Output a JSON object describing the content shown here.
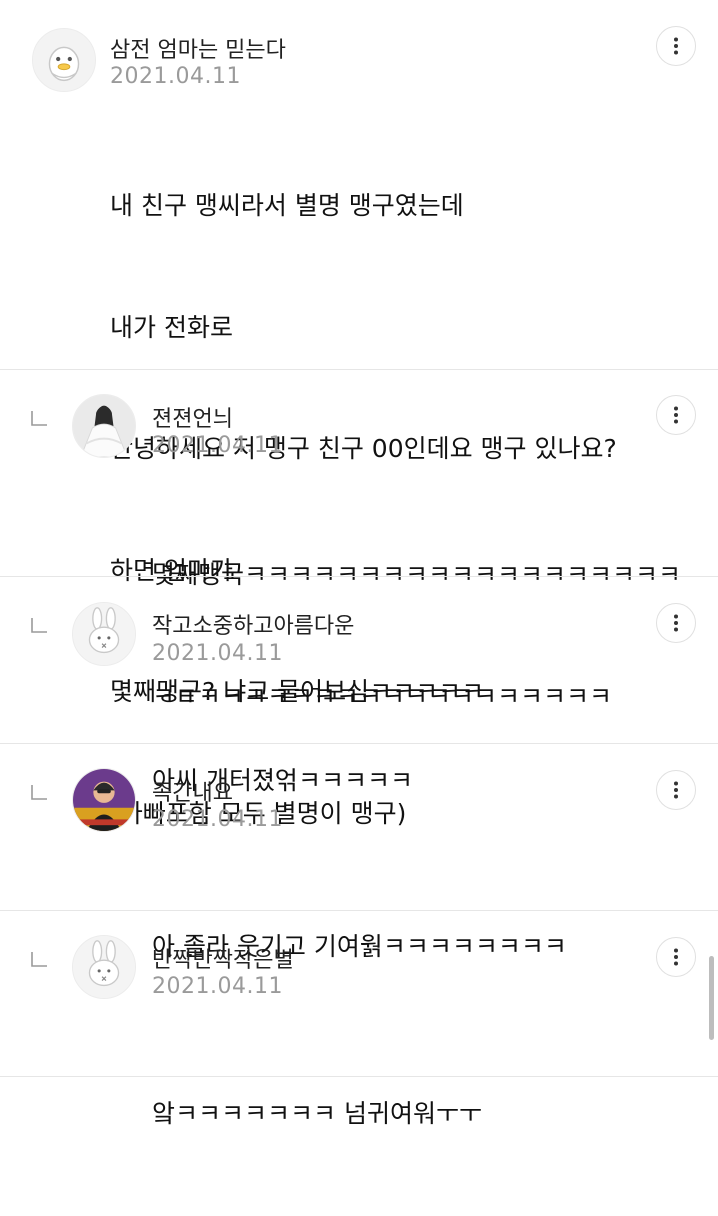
{
  "comments": [
    {
      "author": "삼전 엄마는 믿는다",
      "date": "2021.04.11",
      "avatar": "duck-avatar",
      "lines": [
        "내 친구 맹씨라서 별명 맹구였는데",
        "내가 전화로",
        "안녕하세요 저 맹구 친구 00인데요 맹구 있나요?",
        "하면 엄마가",
        "몇째맹구? 냐고 물어보심ㅋㅋㅋㅋㅋ",
        "(아빠포함 모두 별명이 맹구)"
      ]
    },
    {
      "author": "젼젼언늬",
      "date": "2021.04.11",
      "avatar": "photo-avatar-white-dress",
      "reply": true,
      "lines": [
        "몇째맹국ㅋㅋㅋㅋㅋㅋㅋㅋㅋㅋㅋㅋㅋㅋㅋㅋㅋㅋㅋ",
        "ㅋㅌㅋㅋㅋㅋㅋㅋㅋㅋㅋㅋㅋㅋㅋㅋㅋㅋㅋㅋ"
      ]
    },
    {
      "author": "작고소중하고아름다운",
      "date": "2021.04.11",
      "avatar": "rabbit-avatar",
      "reply": true,
      "lines": [
        "아씨 개터졌얶ㅋㅋㅋㅋㅋ"
      ]
    },
    {
      "author": "족간내요",
      "date": "2021.04.11",
      "avatar": "photo-avatar-man",
      "reply": true,
      "lines": [
        "아 졸라 웃기고 기여웕ㅋㅋㅋㅋㅋㅋㅋㅋ"
      ]
    },
    {
      "author": "반짝반짝작은별",
      "date": "2021.04.11",
      "avatar": "rabbit-avatar",
      "reply": true,
      "lines": [
        "앜ㅋㅋㅋㅋㅋㅋㅋ 넘귀여워ㅜㅜ"
      ]
    }
  ],
  "icons": {
    "more": "more-vertical-icon",
    "reply": "reply-arrow-icon"
  },
  "colors": {
    "date": "#9a9a9a",
    "divider": "#e6e6e6",
    "text": "#111111"
  }
}
